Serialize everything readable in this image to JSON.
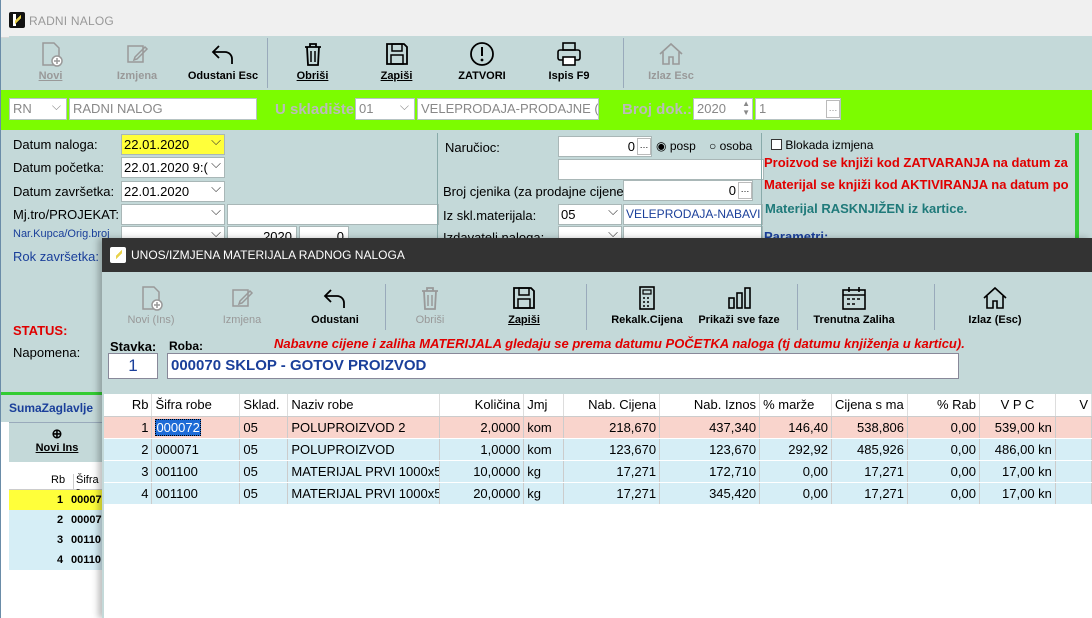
{
  "main_window": {
    "title": "RADNI NALOG",
    "toolbar": [
      {
        "label": "Novi",
        "icon": "new-doc-icon",
        "disabled": true
      },
      {
        "label": "Izmjena",
        "icon": "edit-icon",
        "disabled": true
      },
      {
        "label": "Odustani Esc",
        "icon": "undo-icon",
        "disabled": false
      },
      {
        "label": "Obriši",
        "icon": "trash-icon",
        "disabled": false
      },
      {
        "label": "Zapiši",
        "icon": "save-icon",
        "disabled": false
      },
      {
        "label": "ZATVORI",
        "icon": "alert-icon",
        "disabled": false
      },
      {
        "label": "Ispis F9",
        "icon": "print-icon",
        "disabled": false
      },
      {
        "label": "Izlaz Esc",
        "icon": "home-icon",
        "disabled": true
      }
    ],
    "header": {
      "doc_type": "RN",
      "doc_name": "RADNI NALOG",
      "warehouse_label": "U skladište",
      "warehouse_code": "01",
      "warehouse_name": "VELEPRODAJA-PRODAJNE (",
      "doc_no_label": "Broj dok.:",
      "year": "2020",
      "doc_no": "1"
    },
    "form": {
      "datum_naloga_label": "Datum naloga:",
      "datum_naloga": "22.01.2020",
      "datum_pocetka_label": "Datum početka:",
      "datum_pocetka": "22.01.2020 9:(",
      "datum_zavrsetka_label": "Datum završetka:",
      "datum_zavrsetka": "22.01.2020",
      "mjtro_label": "Mj.tro/PROJEKAT:",
      "narkupca_label": "Nar.Kupca/Orig.broj",
      "narkupca_year": "2020",
      "narkupca_no": "0",
      "rok_label": "Rok završetka:",
      "narucioc_label": "Naručioc:",
      "narucioc_value": "0",
      "posp_label": "posp",
      "osoba_label": "osoba",
      "cjenik_label": "Broj cjenika (za prodajne cijene",
      "cjenik_value": "0",
      "sklmat_label": "Iz skl.materijala:",
      "sklmat_code": "05",
      "sklmat_name": "VELEPRODAJA-NABAVI",
      "izdavatelj_label": "Izdavatelj naloga:",
      "blokada_label": "Blokada izmjena",
      "msg1": "Proizvod se knjiži kod ZATVARANJA na datum za",
      "msg2": "Materijal se knjiži kod AKTIVIRANJA na datum po",
      "msg3": "Materijal RASKNJIŽEN iz kartice.",
      "parametri": "Parametri:",
      "status_label": "STATUS:",
      "napomena_label": "Napomena:"
    },
    "left_panel": {
      "sum_label": "SumaZaglavlje",
      "novi_ins": "Novi Ins",
      "col_rb": "Rb",
      "col_sifra": "Šifra r",
      "rows": [
        {
          "rb": "1",
          "sifra": "00007"
        },
        {
          "rb": "2",
          "sifra": "00007"
        },
        {
          "rb": "3",
          "sifra": "00110"
        },
        {
          "rb": "4",
          "sifra": "00110"
        }
      ]
    }
  },
  "dialog": {
    "title": "UNOS/IZMJENA MATERIJALA RADNOG NALOGA",
    "toolbar": [
      {
        "label": "Novi (Ins)",
        "icon": "new-doc-icon",
        "disabled": true
      },
      {
        "label": "Izmjena",
        "icon": "edit-icon",
        "disabled": true
      },
      {
        "label": "Odustani",
        "icon": "undo-icon",
        "disabled": false
      },
      {
        "label": "Obriši",
        "icon": "trash-icon",
        "disabled": true
      },
      {
        "label": "Zapiši",
        "icon": "save-icon",
        "disabled": false
      },
      {
        "label": "Rekalk.Cijena",
        "icon": "calculator-icon",
        "disabled": false
      },
      {
        "label": "Prikaži sve faze",
        "icon": "bar-chart-icon",
        "disabled": false
      },
      {
        "label": "Trenutna Zaliha",
        "icon": "calendar-icon",
        "disabled": false
      },
      {
        "label": "Izlaz (Esc)",
        "icon": "home-icon",
        "disabled": false
      }
    ],
    "stavka_label": "Stavka:",
    "stavka_value": "1",
    "roba_label": "Roba:",
    "roba_value": "000070  SKLOP - GOTOV PROIZVOD",
    "notice": "Nabavne cijene i zaliha MATERIJALA gledaju se prema datumu POČETKA naloga (tj datumu knjiženja u karticu).",
    "columns": [
      "Rb",
      "Šifra robe",
      "Sklad.",
      "Naziv robe",
      "Količina",
      "Jmj",
      "Nab. Cijena",
      "Nab. Iznos",
      "% marže",
      "Cijena s ma",
      "% Rab",
      "V P C",
      "V"
    ],
    "rows": [
      [
        "1",
        "000072",
        "05",
        "POLUPROIZVOD 2",
        "2,0000",
        "kom",
        "218,670",
        "437,340",
        "146,40",
        "538,806",
        "0,00",
        "539,00 kn",
        ""
      ],
      [
        "2",
        "000071",
        "05",
        "POLUPROIZVOD",
        "1,0000",
        "kom",
        "123,670",
        "123,670",
        "292,92",
        "485,926",
        "0,00",
        "486,00 kn",
        ""
      ],
      [
        "3",
        "001100",
        "05",
        "MATERIJAL PRVI 1000x5",
        "10,0000",
        "kg",
        "17,271",
        "172,710",
        "0,00",
        "17,271",
        "0,00",
        "17,00 kn",
        ""
      ],
      [
        "4",
        "001100",
        "05",
        "MATERIJAL PRVI 1000x5",
        "20,0000",
        "kg",
        "17,271",
        "345,420",
        "0,00",
        "17,271",
        "0,00",
        "17,00 kn",
        ""
      ]
    ]
  },
  "colors": {
    "green_bar": "#7cfc00",
    "panel": "#c4d9d9",
    "selected_row": "#f9d4cc",
    "row": "#d6eef6",
    "status_red": "#e00000"
  }
}
